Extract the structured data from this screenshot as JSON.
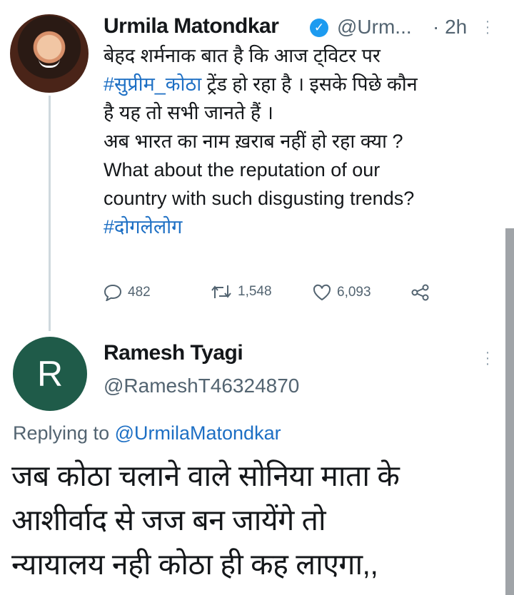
{
  "tweet": {
    "author_name": "Urmila Matondkar",
    "verified_icon": "verified-badge-icon",
    "handle": "@Urm...",
    "time": "· 2h",
    "text_lines": [
      "बेहद शर्मनाक बात है कि आज ट्विटर पर",
      "ट्रेंड हो रहा है । इसके पिछे  कौन",
      "है यह तो सभी जानते हैं ।",
      "अब भारत का नाम ख़राब नहीं हो रहा क्या ?",
      "What about the reputation of our",
      "country with such disgusting trends?"
    ],
    "hashtag_1": "#सुप्रीम_कोठा",
    "hashtag_2": "#दोगलेलोग",
    "stats": {
      "replies": "482",
      "retweets": "1,548",
      "likes": "6,093"
    }
  },
  "reply": {
    "avatar_letter": "R",
    "author_name": "Ramesh Tyagi",
    "handle": "@RameshT46324870",
    "replying_prefix": "Replying to",
    "replying_handle": "@UrmilaMatondkar",
    "text_lines": [
      "जब कोठा चलाने वाले सोनिया माता के",
      "आशीर्वाद से जज बन जायेंगे तो",
      "न्यायालय नही कोठा ही कह लाएगा,,"
    ]
  },
  "colors": {
    "link": "#1d6fc4",
    "secondary_text": "#536471",
    "verified": "#1d9bf0",
    "reply_avatar_bg": "#1f5b49"
  }
}
